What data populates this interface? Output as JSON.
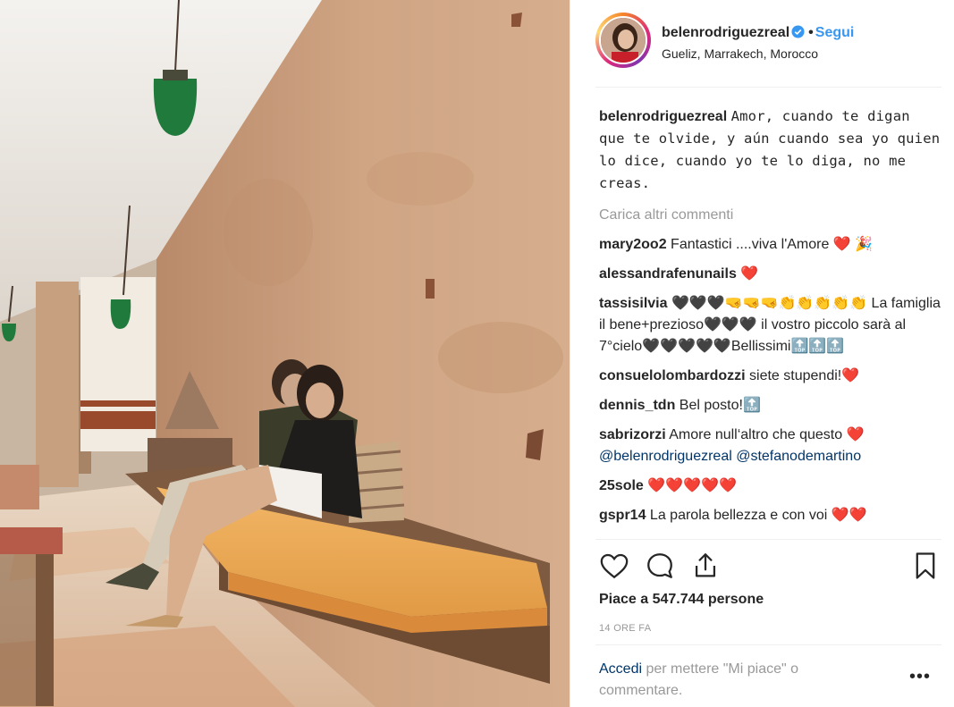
{
  "post": {
    "photo_icon": "photo-of-couple-on-orange-bench",
    "header": {
      "username": "belenrodriguezreal",
      "verified_icon": "verified-badge-icon",
      "separator": "•",
      "follow_label": "Segui",
      "location": "Gueliz, Marrakech, Morocco"
    },
    "caption": {
      "username": "belenrodriguezreal",
      "text": "Amor, cuando te digan que te olvide, y aún cuando sea yo quien lo dice, cuando yo te lo diga, no me creas."
    },
    "load_more": "Carica altri commenti",
    "comments": [
      {
        "username": "mary2oo2",
        "text": "Fantastici ....viva l'Amore ❤️ 🎉"
      },
      {
        "username": "alessandrafenunails",
        "text": "❤️"
      },
      {
        "username": "tassisilvia",
        "text": "🖤🖤🖤🤜🤜🤜👏👏👏👏👏 La famiglia il bene+prezioso🖤🖤🖤 il vostro piccolo sarà al 7°cielo🖤🖤🖤🖤🖤Bellissimi🔝🔝🔝"
      },
      {
        "username": "consuelolombardozzi",
        "text": "siete stupendi!❤️"
      },
      {
        "username": "dennis_tdn",
        "text": "Bel posto!🔝"
      },
      {
        "username": "sabrizorzi",
        "text": "Amore null‘altro che questo ❤️",
        "mentions": "@belenrodriguezreal @stefanodemartino"
      },
      {
        "username": "25sole",
        "text": "❤️❤️❤️❤️❤️"
      },
      {
        "username": "gspr14",
        "text": "La parola bellezza e con voi ❤️❤️"
      }
    ],
    "actions": {
      "like_icon": "heart-outline-icon",
      "comment_icon": "comment-bubble-icon",
      "share_icon": "share-upload-icon",
      "save_icon": "bookmark-icon"
    },
    "likes_text": "Piace a 547.744 persone",
    "timestamp": "14 ORE FA",
    "footer": {
      "login_link": "Accedi",
      "login_rest": "per mettere \"Mi piace\" o commentare.",
      "more_icon": "more-options-icon",
      "more_glyph": "•••"
    }
  },
  "colors": {
    "link": "#003569",
    "follow": "#3897f0",
    "muted": "#999999",
    "text": "#262626",
    "heart": "#e0212f"
  }
}
